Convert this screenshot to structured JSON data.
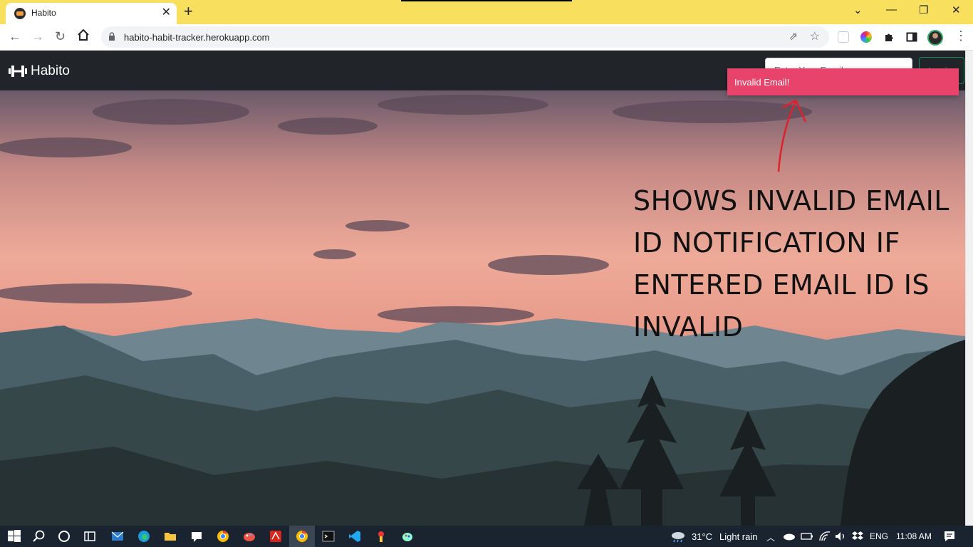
{
  "browser": {
    "tab_title": "Habito",
    "tab_close": "✕",
    "new_tab": "+",
    "url": "habito-habit-tracker.herokuapp.com",
    "window_controls": {
      "dropdown": "⌄",
      "minimize": "—",
      "restore": "❐",
      "close": "✕"
    }
  },
  "site": {
    "brand": "Habito",
    "email_placeholder": "Enter Your Email",
    "login_label": "Login",
    "toast_message": "Invalid Email!"
  },
  "annotation": {
    "text": "SHOWS INVALID EMAIL ID NOTIFICATION IF ENTERED EMAIL ID IS INVALID",
    "arrow_color": "#e0202a"
  },
  "colors": {
    "tabstrip": "#f8df5e",
    "navbar": "#212529",
    "toast": "#e8436b",
    "login_accent": "#198754"
  },
  "taskbar": {
    "weather_temp": "31°C",
    "weather_desc": "Light rain",
    "language": "ENG",
    "time": "11:08 AM",
    "icons": [
      "windows-start-icon",
      "search-icon",
      "cortana-icon",
      "task-view-icon",
      "mail-icon",
      "edge-icon",
      "file-explorer-icon",
      "feedback-icon",
      "chrome-icon",
      "paint-icon",
      "acrobat-icon",
      "chrome-active-icon",
      "terminal-icon",
      "vscode-icon",
      "app-icon",
      "paint3d-icon"
    ]
  }
}
